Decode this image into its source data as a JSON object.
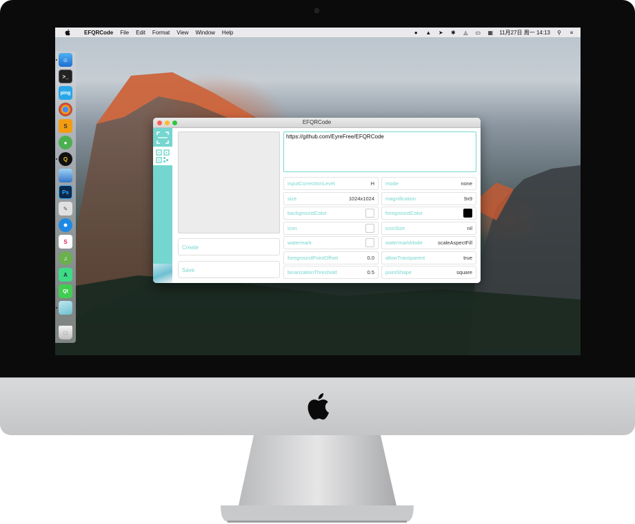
{
  "menubar": {
    "app_name": "EFQRCode",
    "menus": [
      "File",
      "Edit",
      "Format",
      "View",
      "Window",
      "Help"
    ],
    "datetime": "11月27日 周一  14:13"
  },
  "window": {
    "title": "EFQRCode",
    "content_text": "https://github.com/EyreFree/EFQRCode",
    "create_label": "Create",
    "save_label": "Save",
    "params_left": [
      {
        "label": "inputCorrectionLevel",
        "value": "H"
      },
      {
        "label": "size",
        "value": "1024x1024"
      },
      {
        "label": "backgroundColor",
        "value": ""
      },
      {
        "label": "icon",
        "value": ""
      },
      {
        "label": "watermark",
        "value": ""
      },
      {
        "label": "foregroundPointOffset",
        "value": "0.0"
      },
      {
        "label": "binarizationThreshold",
        "value": "0.5"
      }
    ],
    "params_right": [
      {
        "label": "mode",
        "value": "none"
      },
      {
        "label": "magnification",
        "value": "9x9"
      },
      {
        "label": "foregroundColor",
        "value": ""
      },
      {
        "label": "iconSize",
        "value": "nil"
      },
      {
        "label": "watermarkMode",
        "value": "scaleAspectFill"
      },
      {
        "label": "allowTransparent",
        "value": "true"
      },
      {
        "label": "pointShape",
        "value": "square"
      }
    ]
  },
  "colors": {
    "accent": "#75d6cf",
    "background_color_value": "#ffffff",
    "foreground_color_value": "#000000"
  },
  "dock": {
    "apps": [
      "finder-icon",
      "terminal-icon",
      "ping-icon",
      "chrome-icon",
      "sublime-icon",
      "wechat-icon",
      "qq-icon",
      "preview-icon",
      "photoshop-icon",
      "script-editor-icon",
      "safari-icon",
      "slack-icon",
      "music-icon",
      "android-studio-icon",
      "qt-creator-icon",
      "efqrcode-icon",
      "trash-icon"
    ]
  }
}
